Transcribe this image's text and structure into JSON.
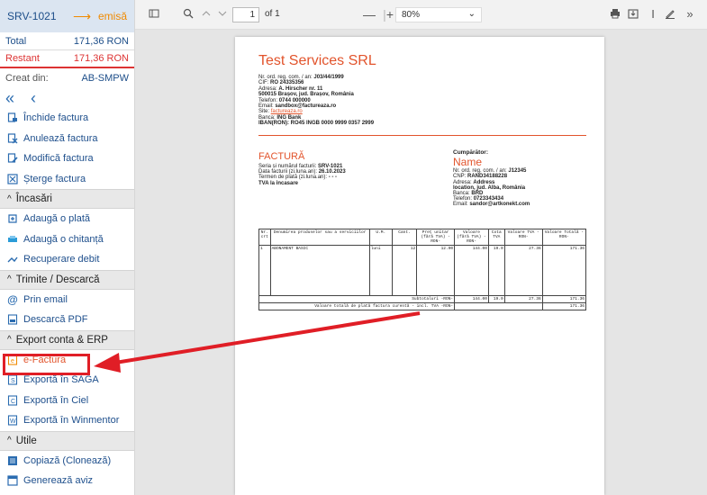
{
  "sidebar": {
    "invoice_number": "SRV-1021",
    "arrow": "⟶",
    "status": "emisă",
    "total_label": "Total",
    "total_value": "171,36 RON",
    "rest_label": "Restant",
    "rest_value": "171,36 RON",
    "created_label": "Creat din:",
    "created_value": "AB-SMPW",
    "nav_first": "«",
    "nav_prev": "‹",
    "actions": [
      {
        "label": "Închide factura",
        "icon": "file-lock-icon"
      },
      {
        "label": "Anulează factura",
        "icon": "file-cancel-icon"
      },
      {
        "label": "Modifică factura",
        "icon": "file-edit-icon"
      },
      {
        "label": "Șterge factura",
        "icon": "delete-icon"
      }
    ],
    "sections": {
      "incasari": {
        "title": "Încasări",
        "items": [
          {
            "label": "Adaugă o plată",
            "icon": "payment-icon"
          },
          {
            "label": "Adaugă o chitanță",
            "icon": "receipt-icon"
          },
          {
            "label": "Recuperare debit",
            "icon": "debt-recovery-icon"
          }
        ]
      },
      "trimite": {
        "title": "Trimite / Descarcă",
        "items": [
          {
            "label": "Prin email",
            "icon": "email-icon"
          },
          {
            "label": "Descarcă PDF",
            "icon": "pdf-icon"
          }
        ]
      },
      "export": {
        "title": "Export conta & ERP",
        "items": [
          {
            "label": "e-Factura",
            "icon": "efactura-icon"
          },
          {
            "label": "Exportă în SAGA",
            "icon": "saga-icon"
          },
          {
            "label": "Exportă în Ciel",
            "icon": "ciel-icon"
          },
          {
            "label": "Exportă în Winmentor",
            "icon": "winmentor-icon"
          }
        ]
      },
      "utile": {
        "title": "Utile",
        "items": [
          {
            "label": "Copiază (Clonează)",
            "icon": "copy-icon"
          },
          {
            "label": "Generează aviz",
            "icon": "document-icon"
          }
        ]
      }
    }
  },
  "toolbar": {
    "page_number": "1",
    "page_of": "of 1",
    "zoom": "80%"
  },
  "document": {
    "company_name": "Test Services SRL",
    "company_reg_label": "Nr. ord. reg. com. / an: ",
    "company_reg": "J03/44/1999",
    "company_cif_label": "CIF: ",
    "company_cif": "RO 24335356",
    "company_address_label": "Adresa: ",
    "company_address1": "A. Hirscher nr. 11",
    "company_address2": "500015 Brașov, jud. Brașov, România",
    "company_phone_label": "Telefon: ",
    "company_phone": "0744 000000",
    "company_email_label": "Email: ",
    "company_email": "sandbox@factureaza.ro",
    "company_site_label": "Site: ",
    "company_site": "factureaza.ro",
    "company_bank_label": "Banca: ",
    "company_bank": "ING Bank",
    "company_iban_label": "IBAN(RON): ",
    "company_iban": "RO45 INGB 0000 9999 0357 2999",
    "invoice_title": "FACTURĂ",
    "series_label": "Seria și numărul facturii:",
    "series_value": "SRV-1021",
    "date_label": "Data facturii (zi.luna.an):",
    "date_value": "26.10.2023",
    "term_label": "Termen de plată (zi.luna.an):",
    "term_value": "- - -",
    "vat_note": "TVA la încasare",
    "buyer_label": "Cumpărător:",
    "buyer_name": "Name",
    "buyer_reg_label": "Nr. ord. reg. com. / an: ",
    "buyer_reg": "J12345",
    "buyer_cnp_label": "CNP: ",
    "buyer_cnp": "RAND34188228",
    "buyer_address_label": "Adresa: ",
    "buyer_address1": "Address",
    "buyer_address2": "location, jud. Alba, România",
    "buyer_bank_label": "Banca: ",
    "buyer_bank": "BRD",
    "buyer_phone_label": "Telefon: ",
    "buyer_phone": "0723343434",
    "buyer_email_label": "Email: ",
    "buyer_email": "sandor@artkonekt.com",
    "table": {
      "headers": [
        "Nr. crt",
        "Denumirea produselor sau a serviciilor",
        "U.M.",
        "Cant.",
        "Preț unitar (fără TVA) -RON-",
        "Valoare (fără TVA) -RON-",
        "Cota TVA",
        "Valoare TVA -RON-",
        "Valoare Totală -RON-"
      ],
      "row": [
        "1",
        "ABONAMENT BASIC",
        "luni",
        "12",
        "12.00",
        "144.00",
        "19.0",
        "27.36",
        "171.36"
      ],
      "subtotal_label": "Subtotaluri -RON-",
      "subtotal": [
        "144.00",
        "19.0",
        "27.36",
        "171.36"
      ],
      "total_label": "Valoare totală de plată factura curentă - incl. TVA -RON-",
      "total_value": "171.36"
    }
  },
  "colors": {
    "accent_orange": "#e2542c",
    "highlight_red": "#e01e26",
    "sidebar_blue": "#1e4f8c"
  }
}
